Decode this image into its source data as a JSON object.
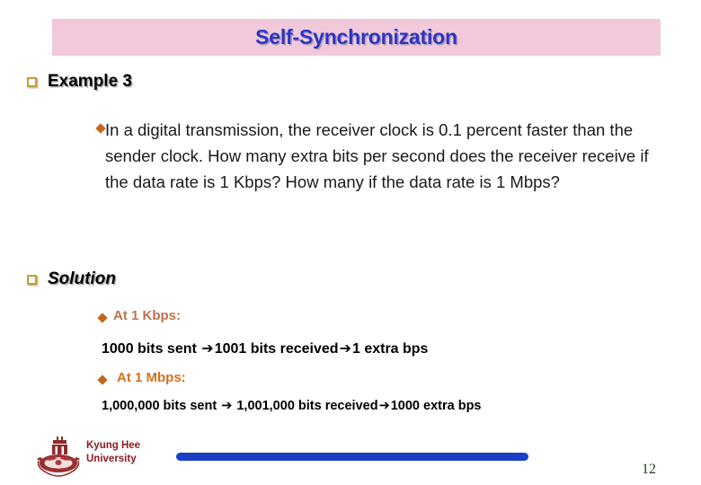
{
  "slide": {
    "title": "Self-Synchronization",
    "title_band_color": "#f2c9da",
    "title_text_color": "#2b35c4"
  },
  "sections": {
    "example": {
      "bullet_icon": "hollow-square-bullet",
      "heading": "Example 3",
      "question_bullet_icon": "diamond-bullet",
      "question": "In a digital transmission, the receiver clock is 0.1 percent faster than the sender clock. How many extra bits per second does the receiver receive if the data rate is 1 Kbps? How many if the data rate is 1 Mbps?"
    },
    "solution": {
      "bullet_icon": "hollow-square-bullet",
      "heading": "Solution",
      "items": [
        {
          "bullet_icon": "diamond-bullet",
          "label": "At 1 Kbps:",
          "label_color": "#c0714c",
          "calc": {
            "part1": "1000 bits sent ",
            "arrow1": "➔",
            "part2": "1001 bits received",
            "arrow2": "➔",
            "part3": "1 extra bps"
          }
        },
        {
          "bullet_icon": "diamond-bullet",
          "label": "At 1 Mbps:",
          "label_color": "#d4711d",
          "calc": {
            "part1": "1,000,000 bits sent ",
            "arrow1": "➔",
            "part2": " 1,001,000 bits received",
            "arrow2": "➔",
            "part3": "1000 extra bps"
          }
        }
      ]
    }
  },
  "footer": {
    "logo_icon": "kyung-hee-university-crest",
    "university_line1": "Kyung Hee",
    "university_line2": "University",
    "university_color": "#8f1a22",
    "rule_color": "#1a3fc4",
    "page_number": "12"
  }
}
